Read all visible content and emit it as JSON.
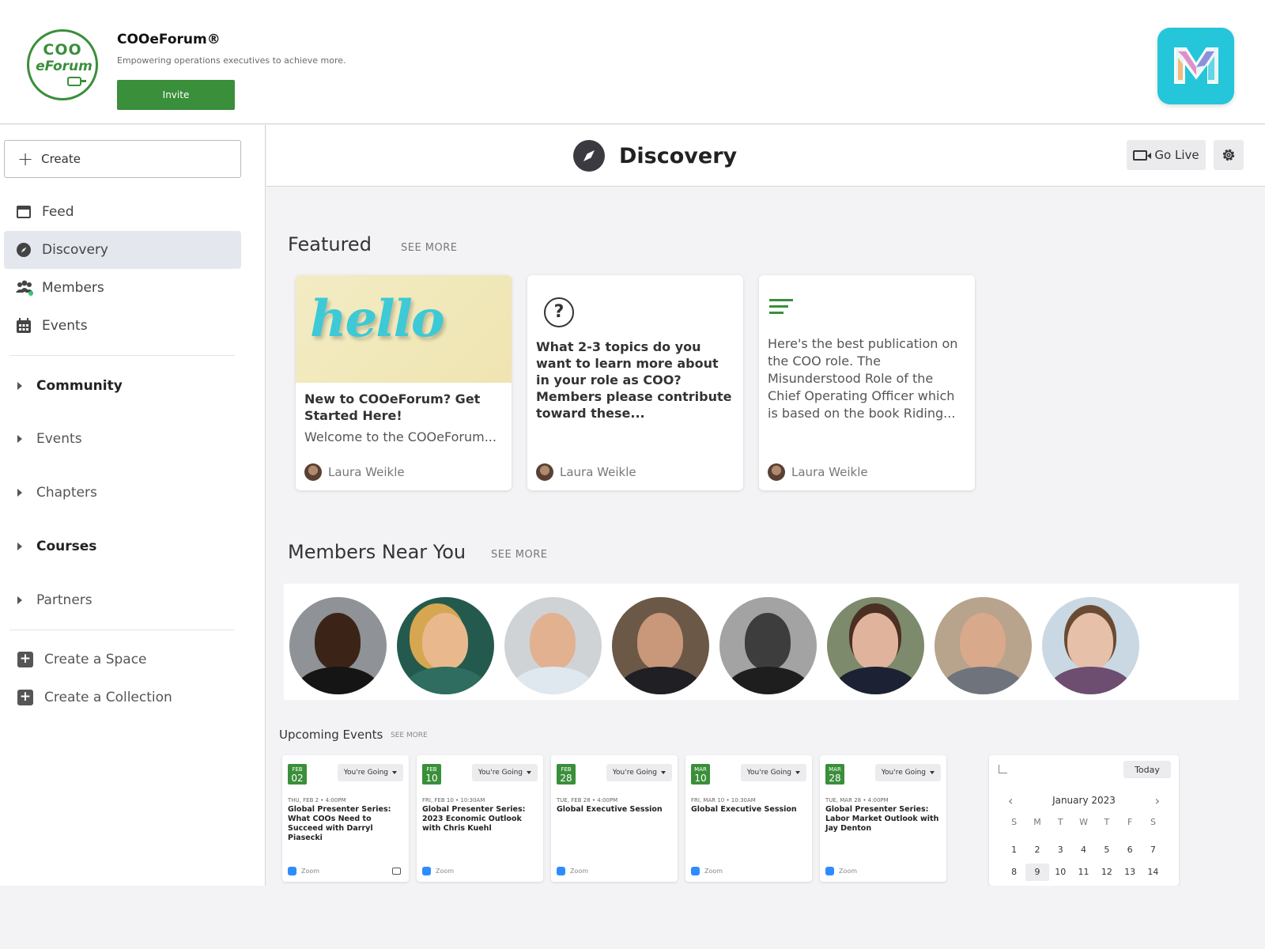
{
  "header": {
    "logo_line1": "COO",
    "logo_line2": "eForum",
    "brand_name": "COOeForum®",
    "tagline": "Empowering operations executives to achieve more.",
    "invite_label": "Invite"
  },
  "sidebar": {
    "create_label": "Create",
    "nav": [
      {
        "label": "Feed",
        "icon": "feed-icon"
      },
      {
        "label": "Discovery",
        "icon": "compass-icon"
      },
      {
        "label": "Members",
        "icon": "members-icon"
      },
      {
        "label": "Events",
        "icon": "calendar-icon"
      }
    ],
    "groups": [
      {
        "label": "Community",
        "bold": true
      },
      {
        "label": "Events",
        "bold": false
      },
      {
        "label": "Chapters",
        "bold": false
      },
      {
        "label": "Courses",
        "bold": true
      },
      {
        "label": "Partners",
        "bold": false
      }
    ],
    "create_space": "Create a Space",
    "create_collection": "Create a Collection"
  },
  "main": {
    "title": "Discovery",
    "go_live": "Go Live",
    "featured": {
      "title": "Featured",
      "see_more": "SEE MORE",
      "cards": [
        {
          "image_text": "hello",
          "title": "New to COOeForum? Get Started Here!",
          "desc": "Welcome to the COOeForum...",
          "author": "Laura Weikle"
        },
        {
          "title": "What 2-3 topics do you want to learn more about in your role as COO? Members please contribute toward these...",
          "author": "Laura Weikle"
        },
        {
          "desc": "Here's the best publication on the COO role. The Misunderstood Role of the Chief Operating Officer which is based on the book Riding...",
          "author": "Laura Weikle"
        }
      ]
    },
    "members_near": {
      "title": "Members Near You",
      "see_more": "SEE MORE"
    },
    "upcoming": {
      "title": "Upcoming Events",
      "see_more": "SEE MORE",
      "going_label": "You're Going",
      "zoom_label": "Zoom",
      "events": [
        {
          "month": "FEB",
          "day": "02",
          "when": "THU, FEB 2 • 4:00PM",
          "title": "Global Presenter Series: What COOs Need to Succeed with Darryl Piasecki"
        },
        {
          "month": "FEB",
          "day": "10",
          "when": "FRI, FEB 10 • 10:30AM",
          "title": "Global Presenter Series: 2023 Economic Outlook with Chris Kuehl"
        },
        {
          "month": "FEB",
          "day": "28",
          "when": "TUE, FEB 28 • 4:00PM",
          "title": "Global Executive Session"
        },
        {
          "month": "MAR",
          "day": "10",
          "when": "FRI, MAR 10 • 10:30AM",
          "title": "Global Executive Session"
        },
        {
          "month": "MAR",
          "day": "28",
          "when": "TUE, MAR 28 • 4:00PM",
          "title": "Global Presenter Series: Labor Market Outlook with Jay Denton"
        }
      ]
    },
    "calendar": {
      "today_label": "Today",
      "month": "January 2023",
      "dow": [
        "S",
        "M",
        "T",
        "W",
        "T",
        "F",
        "S"
      ],
      "week1": [
        "1",
        "2",
        "3",
        "4",
        "5",
        "6",
        "7"
      ],
      "week2": [
        "8",
        "9",
        "10",
        "11",
        "12",
        "13",
        "14"
      ],
      "selected": "9"
    }
  },
  "colors": {
    "brand_green": "#3a8f3a",
    "app_teal": "#25c6d9",
    "active_nav": "#e5e7ee"
  }
}
